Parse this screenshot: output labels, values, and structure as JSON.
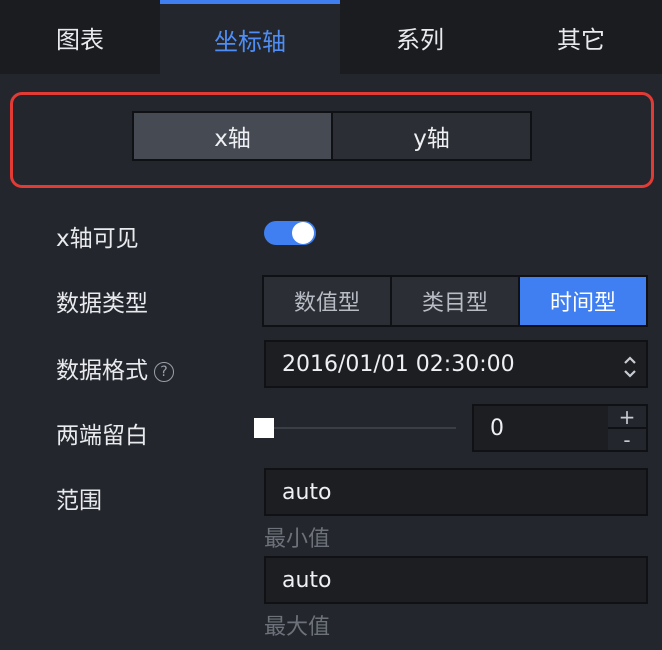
{
  "tabs": [
    "图表",
    "坐标轴",
    "系列",
    "其它"
  ],
  "active_tab": "坐标轴",
  "axis_switch": {
    "x": "x轴",
    "y": "y轴",
    "selected": "x轴"
  },
  "x_visible": {
    "label": "x轴可见",
    "on": true
  },
  "data_type": {
    "label": "数据类型",
    "options": [
      "数值型",
      "类目型",
      "时间型"
    ],
    "selected": "时间型"
  },
  "data_format": {
    "label": "数据格式",
    "help_icon": "?",
    "value": "2016/01/01 02:30:00"
  },
  "padding": {
    "label": "两端留白",
    "value": "0",
    "plus": "+",
    "minus": "-"
  },
  "range": {
    "label": "范围",
    "min_value": "auto",
    "min_hint": "最小值",
    "max_value": "auto",
    "max_hint": "最大值"
  },
  "colors": {
    "accent": "#3f7ff2",
    "highlight_border": "#e23b35",
    "background": "#23262c"
  }
}
